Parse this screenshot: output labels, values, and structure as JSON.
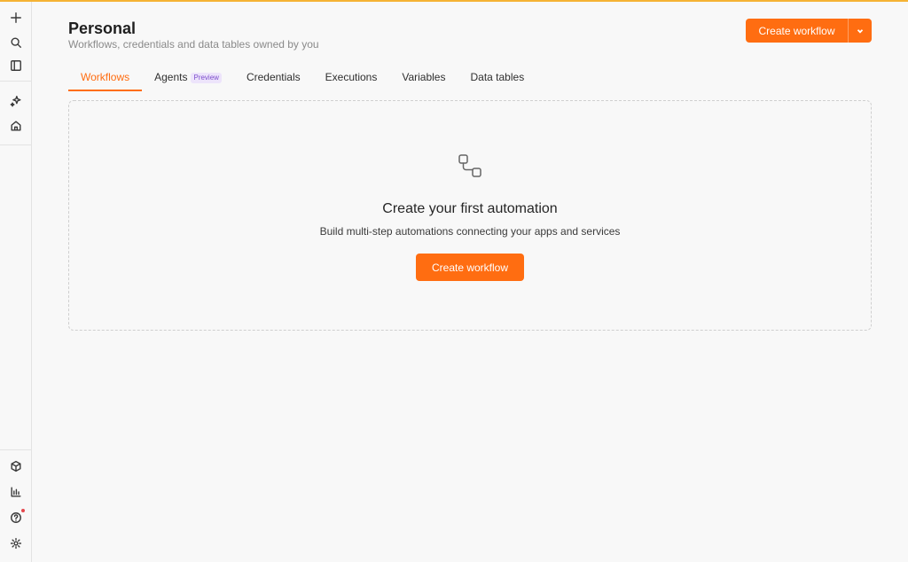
{
  "colors": {
    "accent": "#ff6d11",
    "top_line": "#f5b334",
    "preview_badge": "#7c4dcc",
    "notification_dot": "#e5484d"
  },
  "sidebar": {
    "top_icons": [
      "plus-icon",
      "search-icon",
      "panel-toggle-icon"
    ],
    "middle_icons": [
      "sparkles-icon",
      "home-icon"
    ],
    "bottom_icons": [
      "cube-icon",
      "bar-chart-icon",
      "help-icon",
      "gear-icon"
    ]
  },
  "header": {
    "title": "Personal",
    "subtitle": "Workflows, credentials and data tables owned by you",
    "create_button_label": "Create workflow"
  },
  "tabs": [
    {
      "label": "Workflows",
      "active": true
    },
    {
      "label": "Agents",
      "badge": "Preview"
    },
    {
      "label": "Credentials"
    },
    {
      "label": "Executions"
    },
    {
      "label": "Variables"
    },
    {
      "label": "Data tables"
    }
  ],
  "empty_state": {
    "icon": "workflow-icon",
    "title": "Create your first automation",
    "description": "Build multi-step automations connecting your apps and services",
    "button_label": "Create workflow"
  }
}
